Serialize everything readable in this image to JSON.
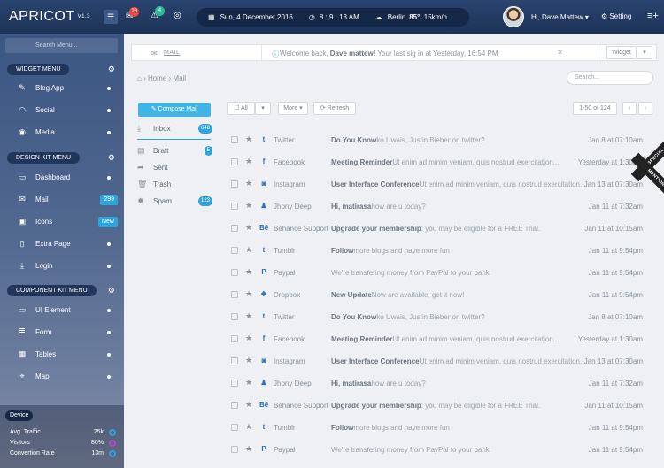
{
  "topbar": {
    "logo": "APRICOT",
    "version": "V1.3",
    "menu_icon": "hamburger-icon",
    "notif_count": "23",
    "alert_count": "4",
    "date": "Sun, 4 December 2016",
    "time": "8 : 9 : 13 AM",
    "location": "Berlin",
    "temp": "85°",
    "wind": "; 15km/h",
    "greeting": "Hi, Dave Mattew",
    "settings": "Setting"
  },
  "sidebar": {
    "search_placeholder": "Search Menu...",
    "widget_menu": "Widget Menu",
    "design_kit_menu": "Design Kit Menu",
    "component_kit_menu": "Component Kit Menu",
    "widget_items": [
      {
        "label": "Blog App",
        "icon": "edit-icon"
      },
      {
        "label": "Social",
        "icon": "rss-icon"
      },
      {
        "label": "Media",
        "icon": "camera-icon"
      }
    ],
    "design_items": [
      {
        "label": "Dashboard",
        "icon": "monitor-icon"
      },
      {
        "label": "Mail",
        "icon": "mail-icon",
        "badge": "299"
      },
      {
        "label": "Icons",
        "icon": "image-icon",
        "badge": "New"
      },
      {
        "label": "Extra Page",
        "icon": "page-icon"
      },
      {
        "label": "Login",
        "icon": "download-icon"
      }
    ],
    "component_items": [
      {
        "label": "UI Element",
        "icon": "desktop-icon"
      },
      {
        "label": "Form",
        "icon": "form-icon"
      },
      {
        "label": "Tables",
        "icon": "table-icon"
      },
      {
        "label": "Map",
        "icon": "pin-icon"
      }
    ],
    "device": {
      "title": "Device",
      "stats": [
        {
          "label": "Avg. Traffic",
          "value": "25k",
          "color": "#2ea4dc"
        },
        {
          "label": "Visitors",
          "value": "80%",
          "color": "#b04ac9"
        },
        {
          "label": "Convertion Rate",
          "value": "13m",
          "color": "#2ea4dc"
        }
      ]
    }
  },
  "crumb": {
    "title": "MAIL",
    "welcome_prefix": "Welcome back,",
    "welcome_name": "Dave mattew!",
    "welcome_suffix": "Your last sig in at Yesterday, 16:54 PM",
    "widget_label": "Widget",
    "home": "Home",
    "current": "Mail",
    "search_placeholder": "Search..."
  },
  "mail": {
    "compose": "Compose Mail",
    "all": "All",
    "more": "More",
    "refresh": "Refresh",
    "pagination": "1-50 of 124",
    "folders": [
      {
        "label": "Inbox",
        "icon": "inbox-icon",
        "badge": "648"
      },
      {
        "label": "Draft",
        "icon": "draft-icon",
        "badge": "5"
      },
      {
        "label": "Sent",
        "icon": "sent-icon"
      },
      {
        "label": "Trash",
        "icon": "trash-icon"
      },
      {
        "label": "Spam",
        "icon": "spam-icon",
        "badge": "123"
      }
    ],
    "ribbon1": "SPECIAL",
    "ribbon2": "MENTION",
    "rows": [
      {
        "icon": "twitter-icon",
        "glyph": "t",
        "source": "Twitter",
        "subject": "Do You Know",
        "preview": "ko Uwais, Justin Bieber on twitter?",
        "date": "Jan 8 at 07:10am"
      },
      {
        "icon": "facebook-icon",
        "glyph": "f",
        "source": "Facebook",
        "subject": "Meeting Reminder",
        "preview": "Ut enim ad minim veniam, quis nostrud exercitation...",
        "date": "Yesterday at 1:30am"
      },
      {
        "icon": "instagram-icon",
        "glyph": "◙",
        "source": "Instagram",
        "subject": "User Interface Conference",
        "preview": "Ut enim ad minim veniam, quis nostrud exercitation...",
        "date": "Jan 13 at 07:30am"
      },
      {
        "icon": "user-icon",
        "glyph": "♟",
        "source": "Jhony Deep",
        "subject": "Hi, matirasa",
        "preview": "how are u today?",
        "date": "Jan 11 at 7:32am"
      },
      {
        "icon": "behance-icon",
        "glyph": "Bē",
        "source": "Behance Support",
        "subject": "Upgrade your membership",
        "preview": "; you may be eligible for a FREE Trial.",
        "date": "Jan 11 at 10:15am"
      },
      {
        "icon": "tumblr-icon",
        "glyph": "t",
        "source": "Tumblr",
        "subject": "Follow",
        "preview": "more blogs and have more fun",
        "date": "Jan 11 at 9:54pm"
      },
      {
        "icon": "paypal-icon",
        "glyph": "P",
        "source": "Paypal",
        "subject": "",
        "preview": "We're transfering money from PayPal to your bank",
        "date": "Jan 11 at 9:54pm"
      },
      {
        "icon": "dropbox-icon",
        "glyph": "❖",
        "source": "Dropbox",
        "subject": "New Update",
        "preview": "Now are available, get it now!",
        "date": "Jan 11 at 9:54pm"
      },
      {
        "icon": "twitter-icon",
        "glyph": "t",
        "source": "Twitter",
        "subject": "Do You Know",
        "preview": "ko Uwais, Justin Bieber on twitter?",
        "date": "Jan 8 at 07:10am"
      },
      {
        "icon": "facebook-icon",
        "glyph": "f",
        "source": "Facebook",
        "subject": "Meeting Reminder",
        "preview": "Ut enim ad minim veniam, quis nostrud exercitation...",
        "date": "Yesterday at 1:30am"
      },
      {
        "icon": "instagram-icon",
        "glyph": "◙",
        "source": "Instagram",
        "subject": "User Interface Conference",
        "preview": "Ut enim ad minim veniam, quis nostrud exercitation...",
        "date": "Jan 13 at 07:30am"
      },
      {
        "icon": "user-icon",
        "glyph": "♟",
        "source": "Jhony Deep",
        "subject": "Hi, matirasa",
        "preview": "how are u today?",
        "date": "Jan 11 at 7:32am"
      },
      {
        "icon": "behance-icon",
        "glyph": "Bē",
        "source": "Behance Support",
        "subject": "Upgrade your membership",
        "preview": "; you may be eligible for a FREE Trial.",
        "date": "Jan 11 at 10:15am"
      },
      {
        "icon": "tumblr-icon",
        "glyph": "t",
        "source": "Tumblr",
        "subject": "Follow",
        "preview": "more blogs and have more fun",
        "date": "Jan 11 at 9:54pm"
      },
      {
        "icon": "paypal-icon",
        "glyph": "P",
        "source": "Paypal",
        "subject": "",
        "preview": "We're transfering money from PayPal to your bank",
        "date": "Jan 11 at 9:54pm"
      }
    ]
  }
}
